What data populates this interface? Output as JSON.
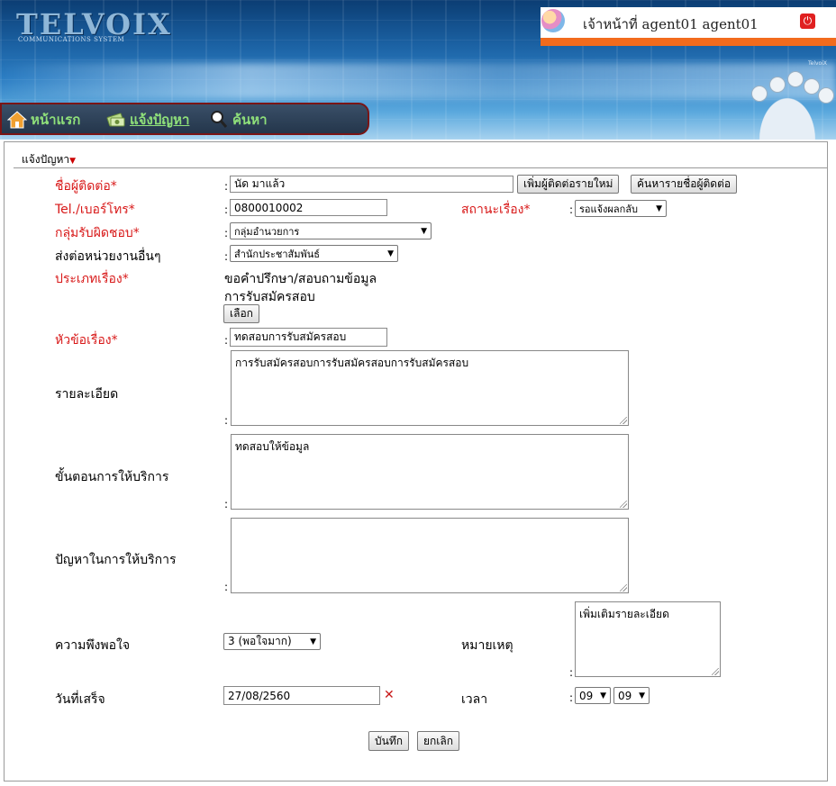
{
  "header": {
    "logo_text": "TELVOIX",
    "logo_sub": "COMMUNICATIONS SYSTEM",
    "brand_small": "TelvoiX",
    "username": "เจ้าหน้าที่ agent01 agent01",
    "power_glyph": "⏻"
  },
  "nav": {
    "items": [
      {
        "label": "หน้าแรก",
        "icon": "home-icon"
      },
      {
        "label": "แจ้งปัญหา",
        "icon": "money-report-icon"
      },
      {
        "label": "ค้นหา",
        "icon": "magnifier-icon"
      }
    ]
  },
  "breadcrumb": {
    "label": "แจ้งปัญหา",
    "arrow": "▼"
  },
  "form": {
    "contact": {
      "label": "ชื่อผู้ติดต่อ*",
      "value": "นัด มาแล้ว",
      "add_button": "เพิ่มผู้ติดต่อรายใหม่",
      "search_button": "ค้นหารายชื่อผู้ติดต่อ"
    },
    "phone": {
      "label": "Tel./เบอร์โทร*",
      "value": "0800010002"
    },
    "status": {
      "label": "สถานะเรื่อง*",
      "value": "รอแจ้งผลกลับ"
    },
    "group": {
      "label": "กลุ่มรับผิดชอบ*",
      "value": "กลุ่มอำนวยการ"
    },
    "forward": {
      "label": "ส่งต่อหน่วยงานอื่นๆ",
      "value": "สำนักประชาสัมพันธ์"
    },
    "category": {
      "label": "ประเภทเรื่อง*",
      "line1": "ขอคำปรึกษา/สอบถามข้อมูล",
      "line2": "การรับสมัครสอบ",
      "choose_button": "เลือก"
    },
    "subject": {
      "label": "หัวข้อเรื่อง*",
      "value": "ทดสอบการรับสมัครสอบ"
    },
    "detail": {
      "label": "รายละเอียด",
      "value": "การรับสมัครสอบการรับสมัครสอบการรับสมัครสอบ"
    },
    "procedure": {
      "label": "ขั้นตอนการให้บริการ",
      "value": "ทดสอบให้ข้อมูล"
    },
    "problem": {
      "label": "ปัญหาในการให้บริการ",
      "value": ""
    },
    "satisfaction": {
      "label": "ความพึงพอใจ",
      "value": "3 (พอใจมาก)"
    },
    "remark": {
      "label": "หมายเหตุ",
      "value": "เพิ่มเติมรายละเอียด"
    },
    "done_date": {
      "label": "วันที่เสร็จ",
      "value": "27/08/2560",
      "clear_glyph": "✕"
    },
    "time": {
      "label": "เวลา",
      "hour": "09",
      "minute": "09"
    },
    "colon": ":"
  },
  "actions": {
    "save": "บันทึก",
    "cancel": "ยกเลิก"
  },
  "colors": {
    "required_label": "#d81818",
    "nav_text": "#8fe07a",
    "orange_bar": "#f26b1d"
  }
}
